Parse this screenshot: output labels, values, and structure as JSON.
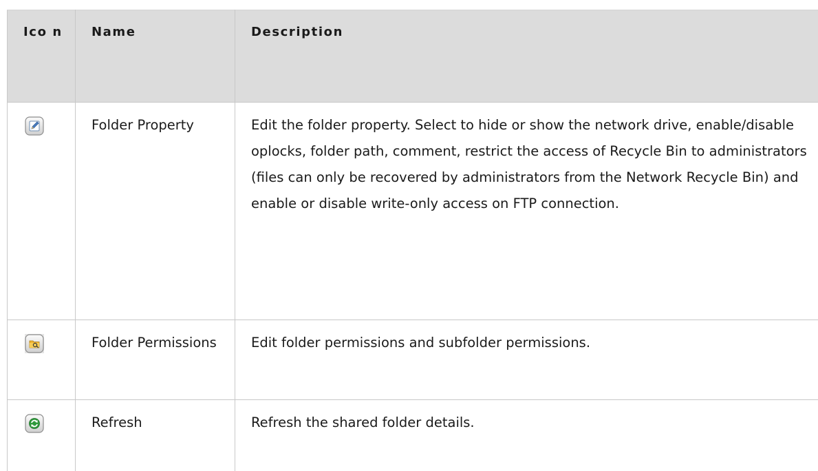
{
  "table": {
    "headers": {
      "icon": "Ico n",
      "name": "Name",
      "description": "Description"
    },
    "rows": [
      {
        "icon": "edit-pencil-icon",
        "name": "Folder Property",
        "description": "Edit the folder property. Select to hide or show the network drive, enable/disable oplocks, folder path, comment, restrict the access of Recycle Bin to administrators (files can only be recovered by administrators from the Network Recycle Bin) and enable or disable write-only access on FTP connection."
      },
      {
        "icon": "folder-permissions-icon",
        "name": "Folder Permissions",
        "description": "Edit folder permissions and subfolder permissions."
      },
      {
        "icon": "refresh-icon",
        "name": "Refresh",
        "description": "Refresh the shared folder details."
      }
    ]
  }
}
